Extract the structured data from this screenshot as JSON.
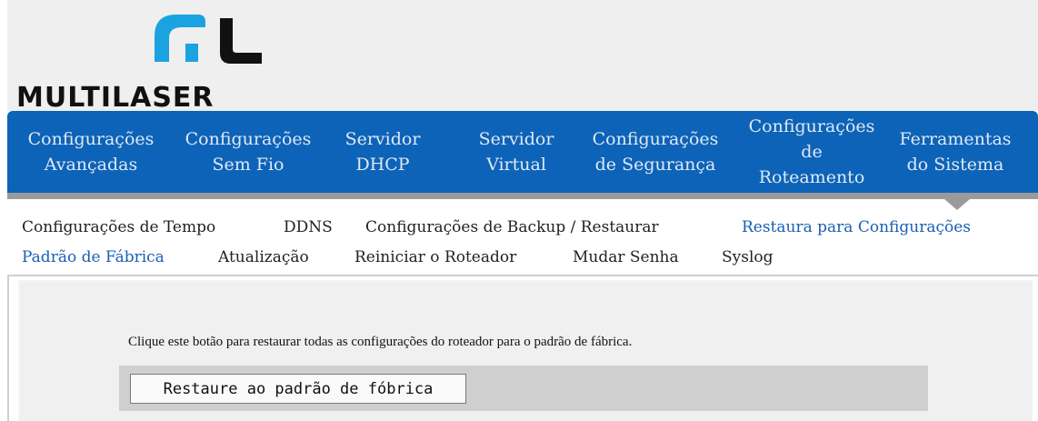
{
  "brand": {
    "name": "MULTILASER",
    "colors": {
      "blue": "#1aa3e0",
      "black": "#111111"
    }
  },
  "main_nav": {
    "background": "#0d63b7",
    "items": [
      {
        "label": "Configurações\nAvançadas"
      },
      {
        "label": "Configurações\nSem Fio"
      },
      {
        "label": "Servidor\nDHCP"
      },
      {
        "label": "Servidor\nVirtual"
      },
      {
        "label": "Configurações\nde Segurança"
      },
      {
        "label": "Configurações\nde\nRoteamento"
      },
      {
        "label": "Ferramentas\ndo Sistema",
        "active": true
      }
    ]
  },
  "sub_nav": {
    "items": [
      {
        "label": "Configurações de Tempo"
      },
      {
        "label": "DDNS"
      },
      {
        "label": "Configurações de Backup / Restaurar"
      },
      {
        "label": "Restaura para Configurações",
        "active": true
      },
      {
        "label": "Padrão de Fábrica",
        "active": true
      },
      {
        "label": "Atualização"
      },
      {
        "label": "Reiniciar o Roteador"
      },
      {
        "label": "Mudar Senha"
      },
      {
        "label": "Syslog"
      }
    ],
    "active_color": "#1a5fb4"
  },
  "content": {
    "instruction": "Clique este botão para restaurar todas as configurações do roteador para o padrão de fábrica.",
    "restore_button_label": "Restaure ao padrão de fóbrica"
  }
}
